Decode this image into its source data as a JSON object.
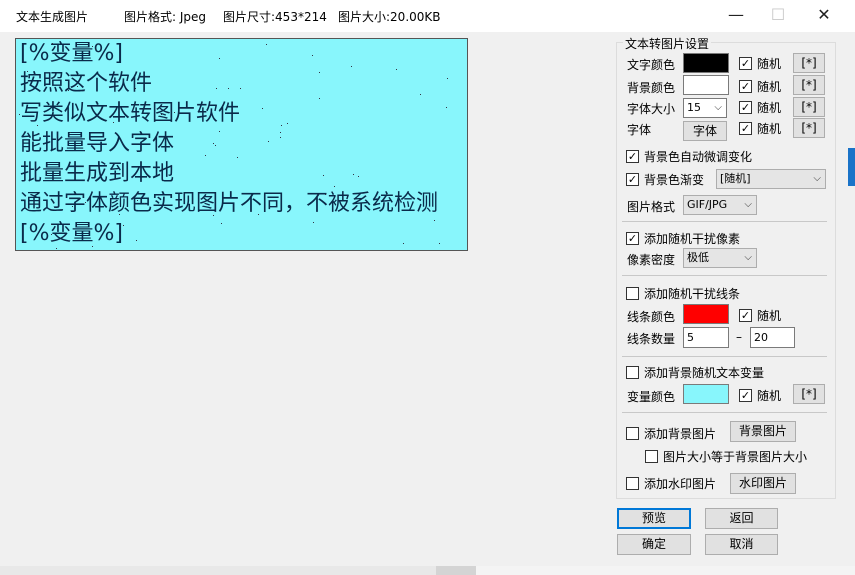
{
  "window": {
    "title": "文本生成图片",
    "format_info": "图片格式: Jpeg",
    "size_info": "图片尺寸:453*214",
    "filesize_info": "图片大小:20.00KB",
    "minimize_glyph": "—",
    "maximize_glyph": "☐",
    "close_glyph": "✕"
  },
  "preview": {
    "background": "#88f6fc",
    "lines": [
      "[%变量%]",
      "按照这个软件",
      "写类似文本转图片软件",
      "能批量导入字体",
      "批量生成到本地",
      "通过字体颜色实现图片不同，不被系统检测",
      "[%变量%]"
    ]
  },
  "settings": {
    "group_title": "文本转图片设置",
    "text_color": {
      "label": "文字颜色",
      "color": "#000000",
      "random_label": "随机",
      "random_checked": true,
      "button": "[*]"
    },
    "bg_color": {
      "label": "背景颜色",
      "color": "#ffffff",
      "random_label": "随机",
      "random_checked": true,
      "button": "[*]"
    },
    "font_size": {
      "label": "字体大小",
      "value": "15",
      "random_label": "随机",
      "random_checked": true,
      "button": "[*]"
    },
    "font": {
      "label": "字体",
      "button_label": "字体",
      "random_label": "随机",
      "random_checked": true,
      "button": "[*]"
    },
    "bg_auto_adjust": {
      "label": "背景色自动微调变化",
      "checked": true
    },
    "bg_gradient": {
      "label": "背景色渐变",
      "checked": true,
      "value": "[随机]"
    },
    "image_format": {
      "label": "图片格式",
      "value": "GIF/JPG"
    },
    "noise_pixels": {
      "label": "添加随机干扰像素",
      "checked": true
    },
    "pixel_density": {
      "label": "像素密度",
      "value": "极低"
    },
    "noise_lines": {
      "label": "添加随机干扰线条",
      "checked": false
    },
    "line_color": {
      "label": "线条颜色",
      "color": "#ff0000",
      "random_label": "随机",
      "random_checked": true
    },
    "line_count": {
      "label": "线条数量",
      "min": "5",
      "dash": "–",
      "max": "20"
    },
    "bg_text_var": {
      "label": "添加背景随机文本变量",
      "checked": false
    },
    "var_color": {
      "label": "变量颜色",
      "color": "#88f6fc",
      "random_label": "随机",
      "random_checked": true,
      "button": "[*]"
    },
    "bg_image": {
      "label": "添加背景图片",
      "checked": false,
      "button_label": "背景图片"
    },
    "size_equal_bg": {
      "label": "图片大小等于背景图片大小",
      "checked": false
    },
    "watermark": {
      "label": "添加水印图片",
      "checked": false,
      "button_label": "水印图片"
    }
  },
  "actions": {
    "preview": "预览",
    "back": "返回",
    "ok": "确定",
    "cancel": "取消"
  },
  "icons": {
    "check": "✓",
    "dropdown": "⌵"
  }
}
